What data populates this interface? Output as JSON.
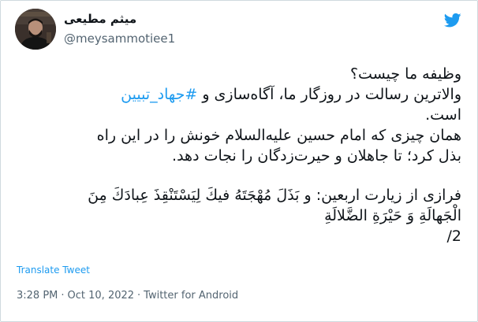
{
  "author": {
    "display_name": "میثم مطیعی",
    "handle": "@meysammotiee1"
  },
  "tweet": {
    "line1": "وظیفه ما چیست؟",
    "line2_text": "والاترین رسالت در روزگار ما، آگاه‌سازی و",
    "hashtag": "#جهاد_تبیین",
    "line3": "است.",
    "line4": "همان چیزی که امام حسین علیه‌السلام خونش را در این راه",
    "line5": "بذل کرد؛ تا جاهلان و حیرت‌زدگان را نجات دهد.",
    "line6": "فرازی از زیارت اربعین: و بَذَلَ مُهْجَتَهُ فيكَ لِيَسْتَنْقِذَ عِبادَكَ مِنَ",
    "line7": "الْجَهالَةِ وَ حَيْرَةِ الضَّلالَةِ",
    "line8": "2/"
  },
  "translate_label": "Translate Tweet",
  "meta": {
    "time": "3:28 PM",
    "date": "Oct 10, 2022",
    "separator": "·",
    "source": "Twitter for Android"
  },
  "colors": {
    "accent": "#1d9bf0",
    "text": "#0f1419",
    "secondary": "#536471",
    "border": "#cfd9de"
  },
  "icons": {
    "brand": "twitter-bird-icon"
  }
}
